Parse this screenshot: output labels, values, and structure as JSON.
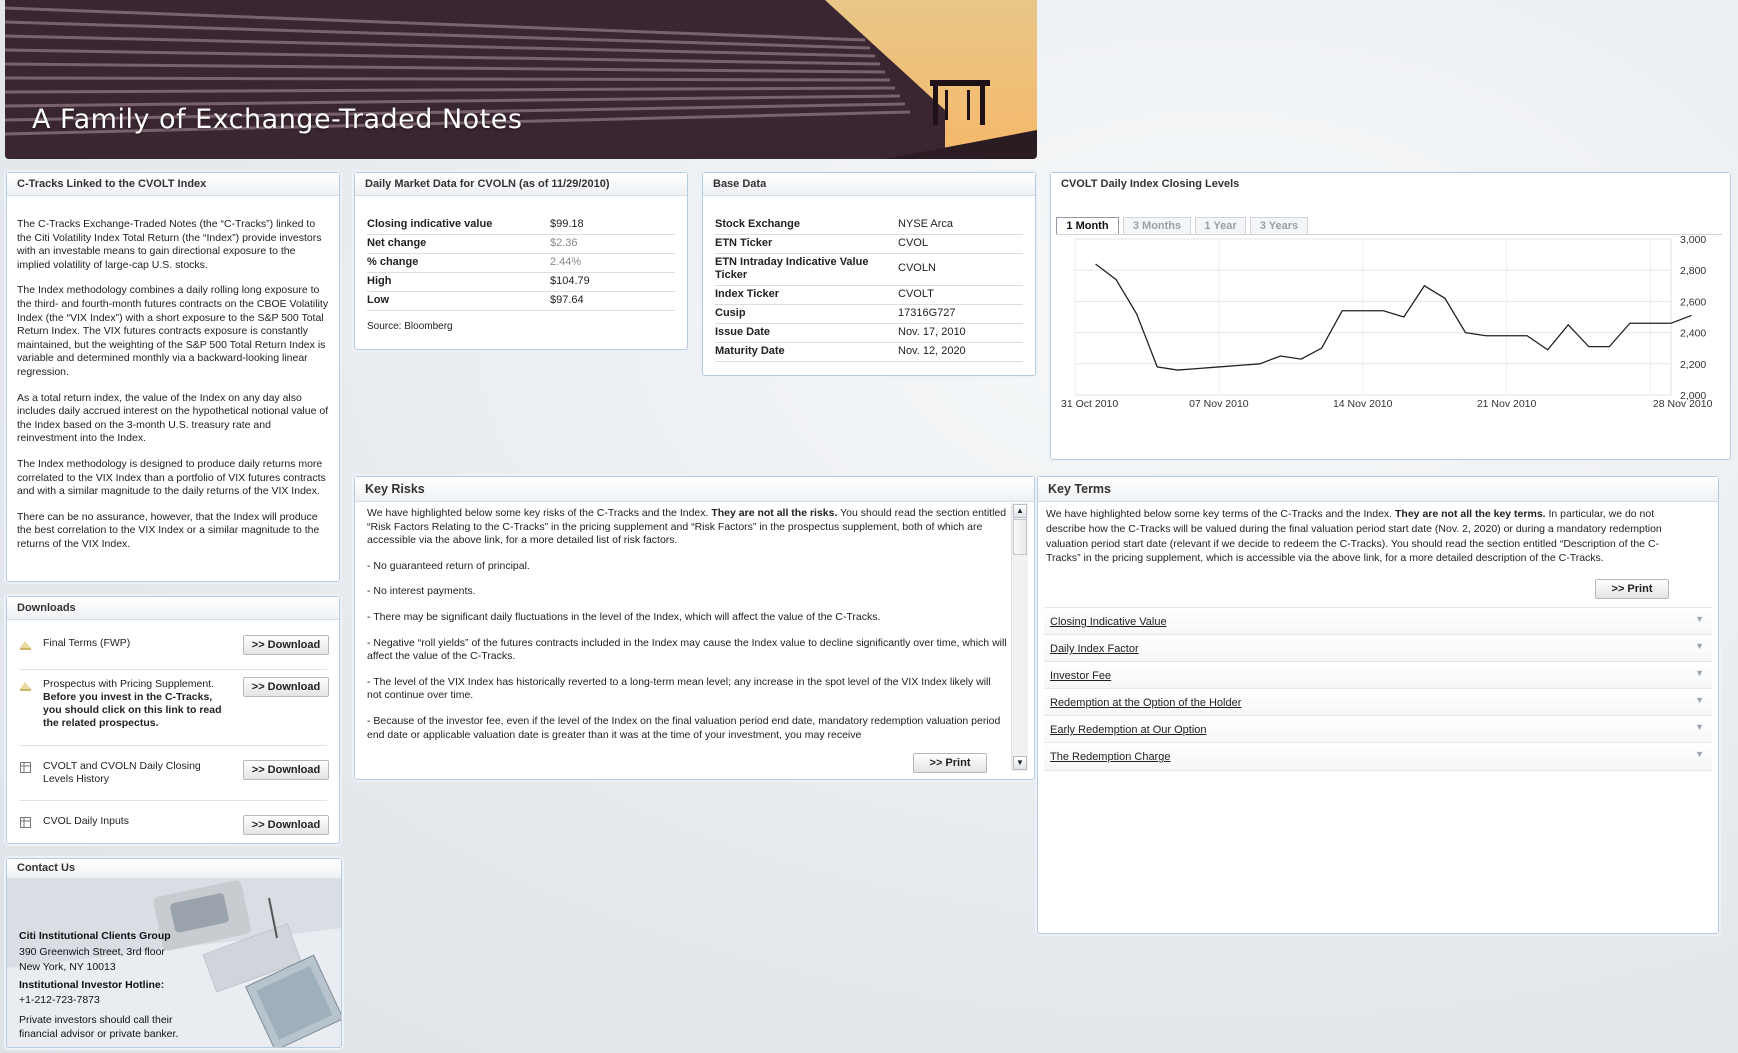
{
  "banner": {
    "title": "A Family of Exchange-Traded Notes"
  },
  "about": {
    "title": "C-Tracks Linked to the CVOLT Index",
    "paragraphs": [
      "The C-Tracks Exchange-Traded Notes (the “C-Tracks”) linked to the Citi Volatility Index Total Return (the “Index”) provide investors with an investable means to gain directional exposure to the implied volatility of large-cap U.S. stocks.",
      "The Index methodology combines a daily rolling long exposure to the third- and fourth-month futures contracts on the CBOE Volatility Index (the “VIX Index”) with a short exposure to the S&P 500 Total Return Index. The VIX futures contracts exposure is constantly maintained, but the weighting of the S&P 500 Total Return Index is variable and determined monthly via a backward-looking linear regression.",
      "As a total return index, the value of the Index on any day also includes daily accrued interest on the hypothetical notional value of the Index based on the 3-month U.S. treasury rate and reinvestment into the Index.",
      "The Index methodology is designed to produce daily returns more correlated to the VIX Index than a portfolio of VIX futures contracts and with a similar magnitude to the daily returns of the VIX Index.",
      "There can be no assurance, however, that the Index will produce the best correlation to the VIX Index or a similar magnitude to the returns of the VIX Index."
    ]
  },
  "market": {
    "title": "Daily Market Data for CVOLN (as of 11/29/2010)",
    "rows": [
      {
        "label": "Closing indicative value",
        "value": "$99.18",
        "muted": false
      },
      {
        "label": "Net change",
        "value": "$2.36",
        "muted": true
      },
      {
        "label": "% change",
        "value": "2.44%",
        "muted": true
      },
      {
        "label": "High",
        "value": "$104.79",
        "muted": false
      },
      {
        "label": "Low",
        "value": "$97.64",
        "muted": false
      }
    ],
    "source": "Source: Bloomberg"
  },
  "base": {
    "title": "Base Data",
    "rows": [
      {
        "label": "Stock Exchange",
        "value": "NYSE Arca"
      },
      {
        "label": "ETN Ticker",
        "value": "CVOL"
      },
      {
        "label": "ETN Intraday Indicative Value Ticker",
        "value": "CVOLN"
      },
      {
        "label": "Index Ticker",
        "value": "CVOLT"
      },
      {
        "label": "Cusip",
        "value": "17316G727"
      },
      {
        "label": "Issue Date",
        "value": "Nov. 17, 2010"
      },
      {
        "label": "Maturity Date",
        "value": "Nov. 12, 2020"
      }
    ]
  },
  "chart": {
    "title": "CVOLT Daily Index Closing Levels",
    "tabs": [
      "1 Month",
      "3 Months",
      "1 Year",
      "3 Years"
    ],
    "active_tab": 0,
    "line_color": "#222222"
  },
  "chart_data": {
    "type": "line",
    "title": "",
    "xlabel": "",
    "ylabel": "",
    "ylim": [
      2000,
      3000
    ],
    "yticks": [
      "3,000",
      "2,800",
      "2,600",
      "2,400",
      "2,200",
      "2,000"
    ],
    "ytick_values": [
      3000,
      2800,
      2600,
      2400,
      2200,
      2000
    ],
    "xticks": [
      "31 Oct 2010",
      "07 Nov 2010",
      "14 Nov 2010",
      "21 Nov 2010",
      "28 Nov 2010"
    ],
    "xtick_days": [
      0,
      7,
      14,
      21,
      28
    ],
    "grid": true,
    "series": [
      {
        "x_days": [
          1,
          2,
          3,
          4,
          5,
          6,
          7,
          8,
          9,
          10,
          11,
          12,
          13,
          14,
          15,
          16,
          17,
          18,
          19,
          20,
          21,
          22,
          23,
          24,
          25,
          26,
          27,
          28,
          29
        ],
        "values": [
          2840,
          2740,
          2520,
          2180,
          2160,
          2170,
          2180,
          2190,
          2200,
          2250,
          2230,
          2300,
          2540,
          2540,
          2540,
          2500,
          2700,
          2620,
          2400,
          2380,
          2380,
          2380,
          2290,
          2450,
          2310,
          2310,
          2460,
          2460,
          2460,
          2510
        ]
      }
    ]
  },
  "downloads": {
    "title": "Downloads",
    "button_label": ">> Download",
    "items": [
      {
        "name": "Final Terms (FWP)",
        "note": ""
      },
      {
        "name": "Prospectus with Pricing Supplement.",
        "note": "Before you invest in the C-Tracks, you should click on this link to read the related prospectus."
      },
      {
        "name": "CVOLT and CVOLN Daily Closing Levels History",
        "note": ""
      },
      {
        "name": "CVOL Daily Inputs",
        "note": ""
      }
    ]
  },
  "risks": {
    "title": "Key Risks",
    "intro_pre": "We have highlighted below some key risks of the C-Tracks and the Index. ",
    "intro_bold": "They are not all the risks.",
    "intro_post": " You should read the section entitled “Risk Factors Relating to the C-Tracks” in the pricing supplement and “Risk Factors” in the prospectus supplement, both of which are accessible via the above link, for a more detailed list of risk factors.",
    "items": [
      "- No guaranteed return of principal.",
      "- No interest payments.",
      "- There may be significant daily fluctuations in the level of the Index, which will affect the value of the C-Tracks.",
      "- Negative “roll yields” of the futures contracts included in the Index may cause the Index value to decline significantly over time, which will affect the value of the C-Tracks.",
      "- The level of the VIX Index has historically reverted to a long-term mean level; any increase in the spot level of the VIX Index likely will not continue over time.",
      "- Because of the investor fee, even if the level of the Index on the final valuation period end date, mandatory redemption valuation period end date or applicable valuation date is greater than it was at the time of your investment, you may receive"
    ],
    "print_label": ">> Print"
  },
  "terms": {
    "title": "Key Terms",
    "intro_pre": "We have highlighted below some key terms of the C-Tracks and the Index. ",
    "intro_bold": "They are not all the key terms.",
    "intro_post": " In particular, we do not describe how the C-Tracks will be valued during the final valuation period start date (Nov. 2, 2020) or during a mandatory redemption valuation period start date (relevant if we decide to redeem the C-Tracks).  You should read the section entitled “Description of the C-Tracks” in the pricing supplement, which is accessible via the above link, for a more detailed description of the C-Tracks.",
    "print_label": ">> Print",
    "items": [
      "Closing Indicative Value",
      "Daily Index Factor",
      "Investor Fee",
      "Redemption at the Option of the Holder",
      "Early Redemption at Our Option",
      "The Redemption Charge"
    ]
  },
  "contact": {
    "title": "Contact Us",
    "org": "Citi Institutional Clients Group",
    "address1": "390 Greenwich Street, 3rd floor",
    "address2": "New York, NY 10013",
    "hotline_label": "Institutional Investor Hotline:",
    "phone": "+1-212-723-7873",
    "private_note": "Private investors should call their financial advisor or private banker."
  }
}
